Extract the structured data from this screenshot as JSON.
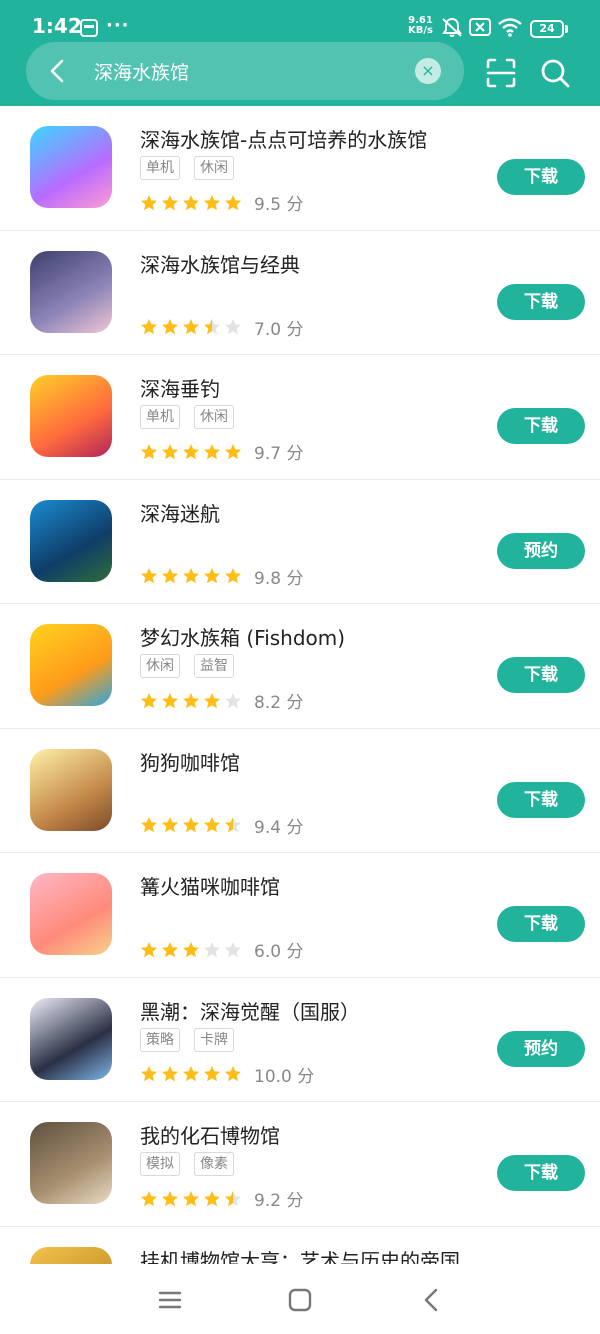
{
  "status_bar": {
    "time": "1:42",
    "dots": "···",
    "net_speed_value": "9.61",
    "net_speed_unit": "KB/s",
    "battery": "24"
  },
  "search": {
    "query": "深海水族馆",
    "clear_symbol": "×"
  },
  "colors": {
    "brand": "#22b39c",
    "star_full": "#ffbd16",
    "star_empty": "#e3e3e3",
    "tag_border": "#d8d8d8"
  },
  "icons": {
    "back": "chevron-left-icon",
    "clear": "clear-icon",
    "scan": "scan-icon",
    "search": "search-icon",
    "nav_menu": "menu-icon",
    "nav_home": "home-icon",
    "nav_back": "back-icon"
  },
  "results": [
    {
      "title": "深海水族馆-点点可培养的水族馆",
      "tags": [
        "单机",
        "休闲"
      ],
      "rating": 5,
      "score": "9.5 分",
      "action": "下载"
    },
    {
      "title": "深海水族馆与经典",
      "tags": [],
      "rating": 3.5,
      "score": "7.0 分",
      "action": "下载"
    },
    {
      "title": "深海垂钓",
      "tags": [
        "单机",
        "休闲"
      ],
      "rating": 5,
      "score": "9.7 分",
      "action": "下载"
    },
    {
      "title": "深海迷航",
      "tags": [],
      "rating": 5,
      "score": "9.8 分",
      "action": "预约"
    },
    {
      "title": "梦幻水族箱 (Fishdom)",
      "tags": [
        "休闲",
        "益智"
      ],
      "rating": 4,
      "score": "8.2 分",
      "action": "下载"
    },
    {
      "title": "狗狗咖啡馆",
      "tags": [],
      "rating": 4.5,
      "score": "9.4 分",
      "action": "下载"
    },
    {
      "title": "篝火猫咪咖啡馆",
      "tags": [],
      "rating": 3,
      "score": "6.0 分",
      "action": "下载"
    },
    {
      "title": "黑潮：深海觉醒（国服）",
      "tags": [
        "策略",
        "卡牌"
      ],
      "rating": 5,
      "score": "10.0 分",
      "action": "预约"
    },
    {
      "title": "我的化石博物馆",
      "tags": [
        "模拟",
        "像素"
      ],
      "rating": 4.5,
      "score": "9.2 分",
      "action": "下载"
    },
    {
      "title": "挂机博物馆大亨：艺术与历史的帝国",
      "tags": [],
      "rating": 0,
      "score": "",
      "action": ""
    }
  ]
}
